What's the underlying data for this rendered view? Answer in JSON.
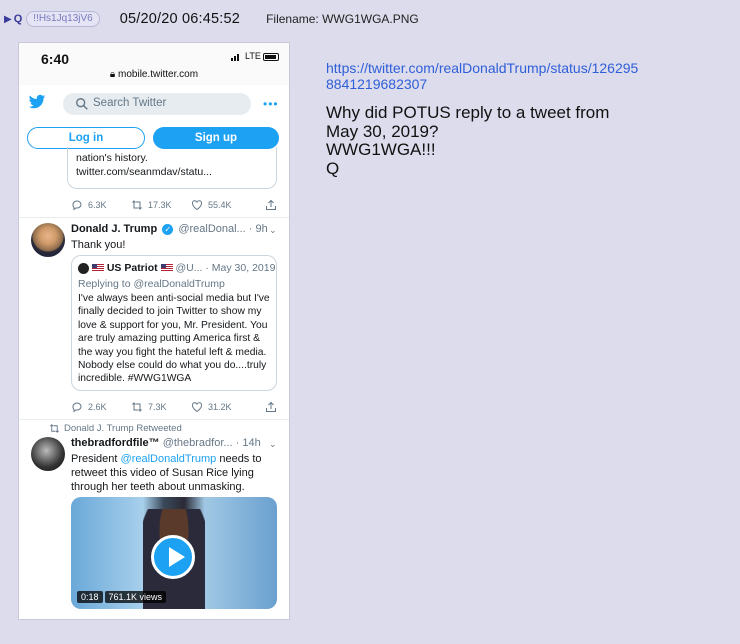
{
  "post": {
    "q_label": "Q",
    "tripcode": "!!Hs1Jq13jV6",
    "datetime": "05/20/20  06:45:52",
    "filename": "Filename: WWG1WGA.PNG",
    "message": {
      "link": "https://twitter.com/realDonaldTrump/status/1262958841219682307",
      "lines": [
        "Why did POTUS reply to a tweet from",
        "May 30, 2019?",
        "WWG1WGA!!!",
        "Q"
      ]
    }
  },
  "phone": {
    "time": "6:40",
    "network": "LTE",
    "url": "mobile.twitter.com"
  },
  "twitter": {
    "search_placeholder": "Search Twitter",
    "more": "•••",
    "login_label": "Log in",
    "signup_label": "Sign up",
    "prev_tweet": {
      "text_line1": "nation's history.",
      "text_line2": "twitter.com/seanmdav/statu...",
      "replies": "6.3K",
      "retweets": "17.3K",
      "likes": "55.4K"
    },
    "trump_tweet": {
      "name": "Donald J. Trump",
      "handle": "@realDonal...",
      "time": "· 9h",
      "text": "Thank you!",
      "quote": {
        "name": "US Patriot",
        "handle": "@U...",
        "date": "· May 30, 2019",
        "replying": "Replying to @realDonaldTrump",
        "text": "I've always been anti-social media but I've finally decided to join Twitter to show my love & support for you, Mr. President. You are truly amazing putting America first & the way you fight the hateful left & media. Nobody else could do what you do....truly incredible. #WWG1WGA"
      },
      "replies": "2.6K",
      "retweets": "7.3K",
      "likes": "31.2K"
    },
    "retweet_tweet": {
      "rt_label": "Donald J. Trump Retweeted",
      "name": "thebradfordfile™",
      "handle": "@thebradfor...",
      "time": "· 14h",
      "text_before": "President ",
      "mention": "@realDonaldTrump",
      "text_after": " needs to retweet this video of Susan Rice lying through her teeth about unmasking.",
      "video_duration": "0:18",
      "video_views": "761.1K views"
    }
  },
  "colors": {
    "twitter_blue": "#1da1f2",
    "post_bg": "#dcdcec",
    "link": "#2f5fd8"
  },
  "icons": [
    "triangle-icon",
    "lock-icon",
    "twitter-bird-icon",
    "search-icon",
    "more-icon",
    "reply-icon",
    "retweet-icon",
    "like-icon",
    "share-icon",
    "verified-icon",
    "chevron-down-icon",
    "play-icon",
    "flag-icon"
  ]
}
